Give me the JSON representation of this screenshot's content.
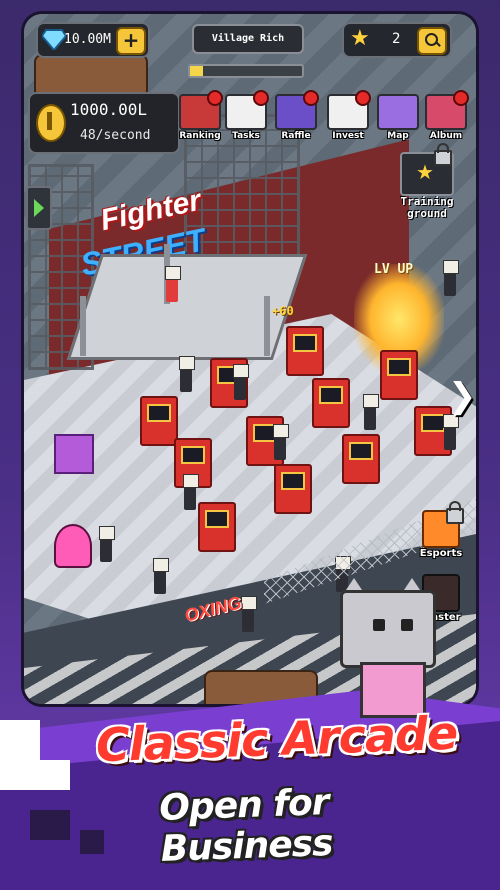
{
  "hud": {
    "gems": "10.00M",
    "title": "Village Rich",
    "progress": 0.12,
    "stars": "2",
    "coins": "1000.00L",
    "rate": "48/second"
  },
  "menu": [
    {
      "label": "Ranking",
      "icon": "ranking-icon",
      "color": "#c83a3a"
    },
    {
      "label": "Tasks",
      "icon": "tasks-icon",
      "color": "#f0f0f0"
    },
    {
      "label": "Raffle",
      "icon": "raffle-icon",
      "color": "#6a4fc9"
    },
    {
      "label": "Invest",
      "icon": "invest-icon",
      "color": "#f0f0f0"
    },
    {
      "label": "Map",
      "icon": "map-icon",
      "color": "#9a6ee0"
    },
    {
      "label": "Album",
      "icon": "album-icon",
      "color": "#d84a6a"
    }
  ],
  "training": {
    "label_line1": "Training",
    "label_line2": "ground"
  },
  "scene": {
    "sign_line1": "Fighter",
    "sign_line2": "STREET",
    "lv_up": "LV UP",
    "bonus": "+60",
    "boxing_sign": "OXING"
  },
  "side": {
    "esports": "Esports",
    "master": "Master"
  },
  "banner": {
    "line1": "Classic Arcade",
    "line2": "Open for Business"
  },
  "colors": {
    "accent_gold": "#f5c53a",
    "banner_purple": "#7a3fd0",
    "headline_red": "#ff3b30"
  }
}
